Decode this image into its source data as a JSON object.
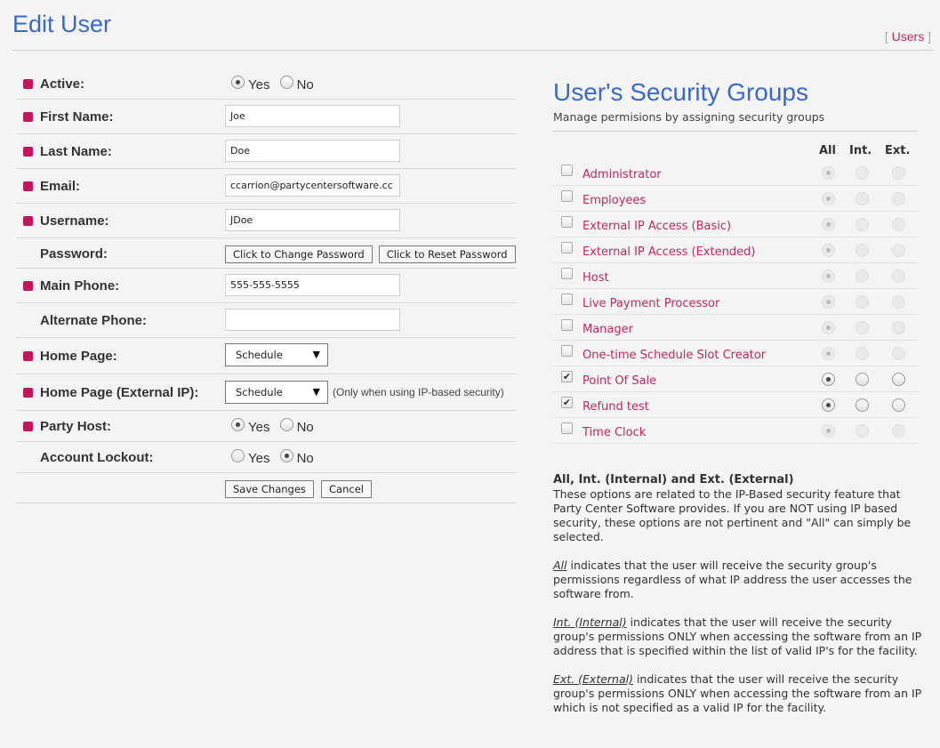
{
  "page": {
    "title": "Edit User",
    "breadcrumb_open": "[ ",
    "breadcrumb_link": "Users",
    "breadcrumb_close": " ]"
  },
  "form": {
    "active": {
      "label": "Active:",
      "yes": "Yes",
      "no": "No",
      "value": "Yes"
    },
    "first_name": {
      "label": "First Name:",
      "value": "Joe"
    },
    "last_name": {
      "label": "Last Name:",
      "value": "Doe"
    },
    "email": {
      "label": "Email:",
      "value": "ccarrion@partycentersoftware.cc"
    },
    "username": {
      "label": "Username:",
      "value": "JDoe"
    },
    "password": {
      "label": "Password:",
      "change_btn": "Click to Change Password",
      "reset_btn": "Click to Reset Password"
    },
    "main_phone": {
      "label": "Main Phone:",
      "value": "555-555-5555"
    },
    "alternate_phone": {
      "label": "Alternate Phone:",
      "value": ""
    },
    "home_page": {
      "label": "Home Page:",
      "value": "Schedule"
    },
    "home_page_ext": {
      "label": "Home Page (External IP):",
      "value": "Schedule",
      "hint": "(Only when using IP-based security)"
    },
    "party_host": {
      "label": "Party Host:",
      "yes": "Yes",
      "no": "No",
      "value": "Yes"
    },
    "account_lockout": {
      "label": "Account Lockout:",
      "yes": "Yes",
      "no": "No",
      "value": "No"
    },
    "save_btn": "Save Changes",
    "cancel_btn": "Cancel"
  },
  "security": {
    "title": "User's Security Groups",
    "subtitle": "Manage permisions by assigning security groups",
    "col_all": "All",
    "col_int": "Int.",
    "col_ext": "Ext.",
    "groups": [
      {
        "name": "Administrator",
        "checked": false,
        "scope": "All"
      },
      {
        "name": "Employees",
        "checked": false,
        "scope": "All"
      },
      {
        "name": "External IP Access (Basic)",
        "checked": false,
        "scope": "All"
      },
      {
        "name": "External IP Access (Extended)",
        "checked": false,
        "scope": "All"
      },
      {
        "name": "Host",
        "checked": false,
        "scope": "All"
      },
      {
        "name": "Live Payment Processor",
        "checked": false,
        "scope": "All"
      },
      {
        "name": "Manager",
        "checked": false,
        "scope": "All"
      },
      {
        "name": "One-time Schedule Slot Creator",
        "checked": false,
        "scope": "All"
      },
      {
        "name": "Point Of Sale",
        "checked": true,
        "scope": "All"
      },
      {
        "name": "Refund test",
        "checked": true,
        "scope": "All"
      },
      {
        "name": "Time Clock",
        "checked": false,
        "scope": "All"
      }
    ]
  },
  "notes": {
    "heading": "All, Int. (Internal) and Ext. (External)",
    "intro": "These options are related to the IP-Based security feature that Party Center Software provides. If you are NOT using IP based security, these options are not pertinent and \"All\" can simply be selected.",
    "all_term": "All",
    "all_text": " indicates that the user will receive the security group's permissions regardless of what IP address the user accesses the software from.",
    "int_term": "Int. (Internal)",
    "int_text": " indicates that the user will receive the security group's permissions ONLY when accessing the software from an IP address that is specified within the list of valid IP's for the facility.",
    "ext_term": "Ext. (External)",
    "ext_text": " indicates that the user will receive the security group's permissions ONLY when accessing the software from an IP which is not specified as a valid IP for the facility."
  }
}
